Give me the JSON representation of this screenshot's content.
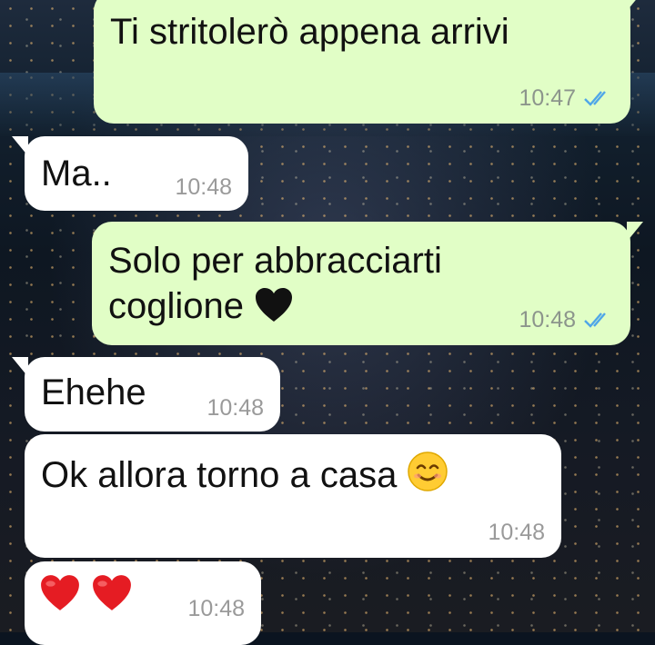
{
  "messages": [
    {
      "text": "Ti stritolerò appena arrivi",
      "time": "10:47",
      "direction": "outgoing",
      "status": "read"
    },
    {
      "text": "Ma..",
      "time": "10:48",
      "direction": "incoming"
    },
    {
      "line1": "Solo per abbracciarti",
      "line2": "coglione",
      "emoji": "black-heart",
      "time": "10:48",
      "direction": "outgoing",
      "status": "read"
    },
    {
      "text": "Ehehe",
      "time": "10:48",
      "direction": "incoming"
    },
    {
      "text": "Ok allora torno a casa",
      "emoji": "smiling-face",
      "time": "10:48",
      "direction": "incoming"
    },
    {
      "emoji": "two-red-hearts",
      "time": "10:48",
      "direction": "incoming"
    }
  ],
  "colors": {
    "outgoing": "#e1fec6",
    "incoming": "#ffffff",
    "read_ticks": "#4fa6e8",
    "meta_text": "#8c958c"
  }
}
